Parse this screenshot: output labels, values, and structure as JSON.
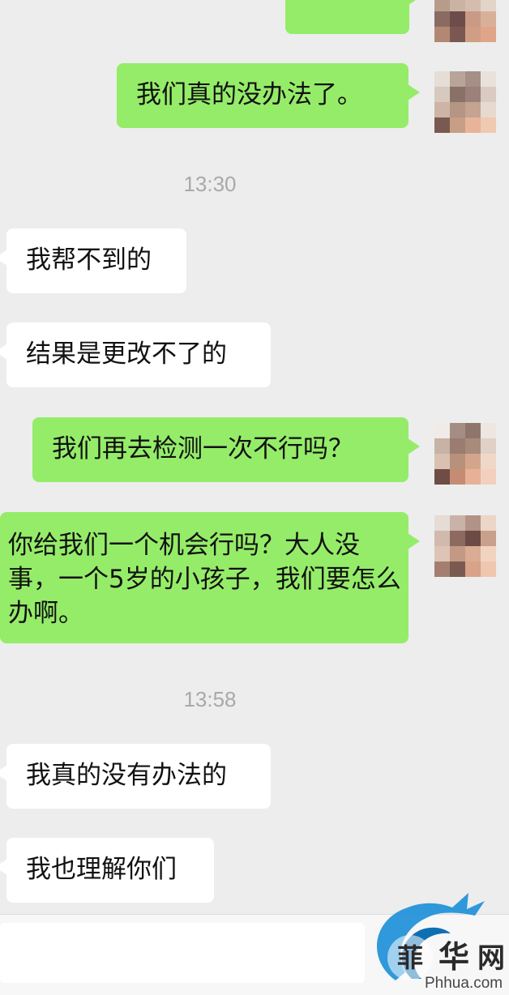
{
  "messages": [
    {
      "side": "right",
      "text": "我们真的没办法了。"
    },
    {
      "side": "left",
      "text": "我帮不到的"
    },
    {
      "side": "left",
      "text": "结果是更改不了的"
    },
    {
      "side": "right",
      "text": "我们再去检测一次不行吗？"
    },
    {
      "side": "right",
      "text": "你给我们一个机会行吗？大人没事，一个5岁的小孩子，我们要怎么办啊。"
    },
    {
      "side": "left",
      "text": "我真的没有办法的"
    },
    {
      "side": "left",
      "text": "我也理解你们"
    }
  ],
  "timestamps": [
    "13:30",
    "13:58"
  ],
  "watermark": {
    "logo_char_1": "菲",
    "logo_char_2": "华",
    "logo_char_3": "网",
    "site": "Phhua.com"
  },
  "colors": {
    "background": "#ededed",
    "sent_bubble": "#95ec69",
    "received_bubble": "#ffffff",
    "timestamp": "#a9a9a9",
    "watermark_blue": "#1e90d8"
  },
  "icons": {
    "avatar": "blurred-avatar",
    "watermark": "dragon-logo-icon"
  }
}
